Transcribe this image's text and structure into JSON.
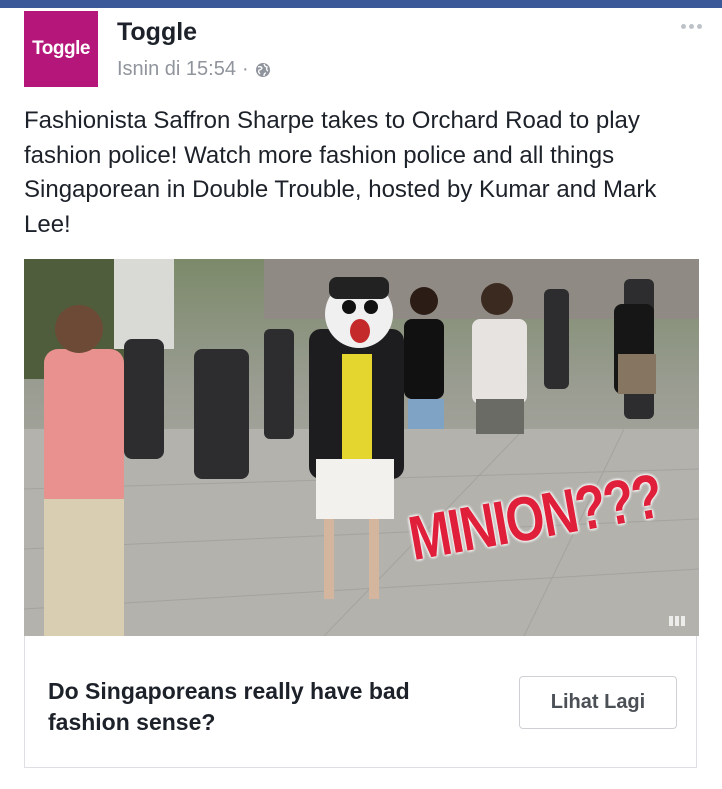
{
  "page": {
    "name": "Toggle",
    "avatar_text": "Toggle",
    "timestamp": "Isnin di 15:54",
    "separator": "·",
    "privacy_icon": "globe-icon",
    "more_icon": "more-options-icon"
  },
  "post": {
    "text": "Fashionista Saffron Sharpe takes to Orchard Road to play fashion police! Watch more fashion police and all things Singaporean in Double Trouble, hosted by Kumar and Mark Lee!"
  },
  "media": {
    "overlay_text": "MINION???",
    "watermark_icon": "video-watermark-icon"
  },
  "link": {
    "caption": "Do Singaporeans really have bad fashion sense?",
    "cta_label": "Lihat Lagi"
  },
  "colors": {
    "top_bar": "#3b5998",
    "avatar_bg": "#b4167a",
    "overlay_text": "#e0203a",
    "meta_text": "#90949c"
  }
}
